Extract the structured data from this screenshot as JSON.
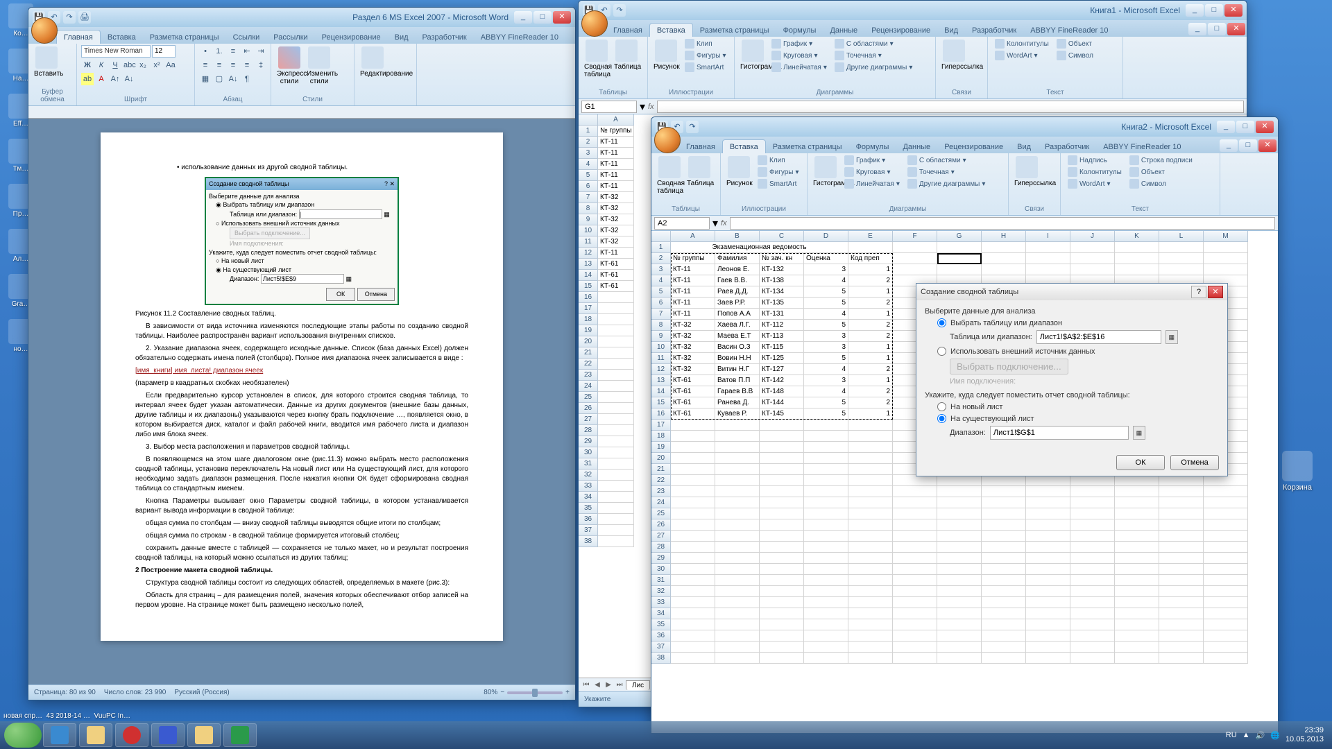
{
  "desktop": {
    "icons": [
      "Ко…",
      "На…",
      "Eff…",
      "Тм…",
      "Пр…",
      "Ал…",
      "Gra…",
      "но…"
    ],
    "recycle": "Корзина"
  },
  "word": {
    "title": "Раздел 6 MS Excel 2007 - Microsoft Word",
    "tabs": [
      "Главная",
      "Вставка",
      "Разметка страницы",
      "Ссылки",
      "Рассылки",
      "Рецензирование",
      "Вид",
      "Разработчик",
      "ABBYY FineReader 10"
    ],
    "font": {
      "name": "Times New Roman",
      "size": "12"
    },
    "groups": {
      "clipboard": "Буфер обмена",
      "font": "Шрифт",
      "para": "Абзац",
      "styles": "Стили",
      "edit": "Редактирование",
      "btn_paste": "Вставить",
      "btn_quick": "Экспресс-стили",
      "btn_change": "Изменить стили"
    },
    "doc": {
      "bullet": "использование данных из другой сводной таблицы.",
      "fig_title": "Создание сводной таблицы",
      "fig_l1": "Выберите данные для анализа",
      "fig_r1": "Выбрать таблицу или диапазон",
      "fig_lbl1": "Таблица или диапазон:",
      "fig_r2": "Использовать внешний источник данных",
      "fig_btn1": "Выбрать подключение...",
      "fig_conn": "Имя подключения:",
      "fig_l2": "Укажите, куда следует поместить отчет сводной таблицы:",
      "fig_r3": "На новый лист",
      "fig_r4": "На существующий лист",
      "fig_lbl2": "Диапазон:",
      "fig_val": "Лист5!$E$9",
      "fig_ok": "ОК",
      "fig_cancel": "Отмена",
      "caption": "Рисунок 11.2  Составление сводных таблиц.",
      "p1": "В зависимости от вида источника изменяются последующие этапы работы по созданию сводной таблицы. Наиболее распространён вариант использования внутренних списков.",
      "p2": "2. Указание диапазона ячеек, содержащего исходные данные. Список (база данных Excel) должен обязательно содержать имена полей (столбцов). Полное имя диапазона ячеек записывается в виде :",
      "p3": "[имя_книги] имя_листа! диапазон ячеек",
      "p3b": "(параметр в квадратных скобках необязателен)",
      "p4": "Если предварительно курсор установлен в список, для которого строится сводная таблица, то интервал ячеек будет указан автоматически. Данные из других документов (внешние базы данных, другие таблицы и их диапазоны) указываются через кнопку брать подключение …, появляется окно, в котором выбирается диск, каталог и файл рабочей книги, вводится имя рабочего листа и диапазон либо имя блока ячеек.",
      "p5": "3. Выбор места расположения и параметров сводной таблицы.",
      "p6": "В появляющемся на этом шаге диалоговом окне (рис.11.3) можно выбрать место расположения сводной таблицы, установив переключатель На новый лист или На существующий лист, для которого необходимо задать диапазон размещения. После нажатия кнопки ОК будет сформирована сводная таблица со стандартным именем.",
      "p7": "Кнопка Параметры вызывает окно Параметры сводной таблицы, в котором устанавливается вариант вывода информации в сводной таблице:",
      "p8": "общая сумма по столбцам — внизу сводной таблицы выводятся общие итоги по столбцам;",
      "p9": "общая сумма по строкам - в сводной таблице формируется итоговый столбец;",
      "p10": "сохранить данные вместе с таблицей — сохраняется не только макет, но и результат построения сводной таблицы, на который можно ссылаться из других таблиц;",
      "h2": "2 Построение макета сводной таблицы.",
      "p11": "Структура сводной таблицы состоит из следующих областей, определяемых в макете (рис.3):",
      "p12": "Область  для страниц – для  размещения полей, значения которых обеспечивают отбор записей на первом уровне. На странице  может быть размещено несколько полей,"
    },
    "status": {
      "page": "Страница: 80 из 90",
      "words": "Число слов: 23 990",
      "lang": "Русский (Россия)",
      "zoom": "80%"
    }
  },
  "excel1": {
    "title": "Книга1 - Microsoft Excel",
    "tabs": [
      "Главная",
      "Вставка",
      "Разметка страницы",
      "Формулы",
      "Данные",
      "Рецензирование",
      "Вид",
      "Разработчик",
      "ABBYY FineReader 10"
    ],
    "active_tab": "Вставка",
    "groups": {
      "tables": "Таблицы",
      "ill": "Иллюстрации",
      "charts": "Диаграммы",
      "links": "Связи",
      "text": "Текст",
      "pivot": "Сводная таблица",
      "table": "Таблица",
      "pic": "Рисунок",
      "clip": "Клип",
      "shapes": "Фигуры",
      "smart": "SmartArt",
      "col": "Гистограмма",
      "pie": "Круговая",
      "bar": "Линейчатая",
      "line": "График",
      "area": "С областями",
      "scatter": "Точечная",
      "other": "Другие диаграммы",
      "hyper": "Гиперссылка",
      "hf": "Колонтитулы",
      "wa": "WordArt",
      "obj": "Объект",
      "sym": "Символ"
    },
    "namebox": "G1",
    "colA_label": "A",
    "colB": "№ группы",
    "rows": [
      "",
      "№ группы",
      "КТ-11",
      "КТ-11",
      "КТ-11",
      "КТ-11",
      "КТ-11",
      "КТ-32",
      "КТ-32",
      "КТ-32",
      "КТ-32",
      "КТ-32",
      "КТ-11",
      "КТ-61",
      "КТ-61",
      "КТ-61"
    ],
    "sheet_tabs_nav": "Лис",
    "status": "Укажите"
  },
  "excel2": {
    "title": "Книга2 - Microsoft Excel",
    "tabs": [
      "Главная",
      "Вставка",
      "Разметка страницы",
      "Формулы",
      "Данные",
      "Рецензирование",
      "Вид",
      "Разработчик",
      "ABBYY FineReader 10"
    ],
    "active_tab": "Вставка",
    "namebox": "A2",
    "cols": [
      "A",
      "B",
      "C",
      "D",
      "E",
      "F",
      "G",
      "H",
      "I",
      "J",
      "K",
      "L",
      "M"
    ],
    "header_row": "Экзаменационная ведомость",
    "row2": [
      "№ группы",
      "Фамилия",
      "№ зач. кн",
      "Оценка",
      "Код преп"
    ],
    "data": [
      [
        "КТ-11",
        "Леонов Е.",
        "КТ-132",
        "3",
        "1"
      ],
      [
        "КТ-11",
        "Гаев В.В.",
        "КТ-138",
        "4",
        "2"
      ],
      [
        "КТ-11",
        "Раев Д.Д.",
        "КТ-134",
        "5",
        "1"
      ],
      [
        "КТ-11",
        "Заев Р.Р.",
        "КТ-135",
        "5",
        "2"
      ],
      [
        "КТ-11",
        "Попов А.А",
        "КТ-131",
        "4",
        "1"
      ],
      [
        "КТ-32",
        "Хаева Л.Г.",
        "КТ-112",
        "5",
        "2"
      ],
      [
        "КТ-32",
        "Маева Е.Т",
        "КТ-113",
        "3",
        "2"
      ],
      [
        "КТ-32",
        "Васин О.З",
        "КТ-115",
        "3",
        "1"
      ],
      [
        "КТ-32",
        "Вовин Н.Н",
        "КТ-125",
        "5",
        "1"
      ],
      [
        "КТ-32",
        "Витин Н.Г",
        "КТ-127",
        "4",
        "2"
      ],
      [
        "КТ-61",
        "Ватов П.П",
        "КТ-142",
        "3",
        "1"
      ],
      [
        "КТ-61",
        "Гараев В.В",
        "КТ-148",
        "4",
        "2"
      ],
      [
        "КТ-61",
        "Ранева Д.",
        "КТ-144",
        "5",
        "2"
      ],
      [
        "КТ-61",
        "Куваев Р.",
        "КТ-145",
        "5",
        "1"
      ]
    ]
  },
  "dialog": {
    "title": "Создание сводной таблицы",
    "l1": "Выберите данные для анализа",
    "r1": "Выбрать таблицу или диапазон",
    "lbl1": "Таблица или диапазон:",
    "val1": "Лист1!$A$2:$E$16",
    "r2": "Использовать внешний источник данных",
    "btn_conn": "Выбрать подключение...",
    "conn": "Имя подключения:",
    "l2": "Укажите, куда следует поместить отчет сводной таблицы:",
    "r3": "На новый лист",
    "r4": "На существующий лист",
    "lbl2": "Диапазон:",
    "val2": "Лист1!$G$1",
    "ok": "ОК",
    "cancel": "Отмена"
  },
  "taskbar": {
    "lang": "RU",
    "time": "23:39",
    "date": "10.05.2013",
    "labels": [
      "новая спр…",
      "43 2018-14 …",
      "VuuPC In…"
    ]
  }
}
